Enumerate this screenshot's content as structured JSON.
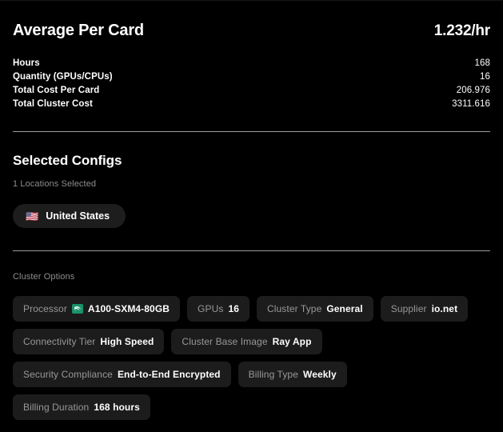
{
  "summary": {
    "title": "Average Per Card",
    "value": "1.232/hr",
    "stats": [
      {
        "label": "Hours",
        "value": "168"
      },
      {
        "label": "Quantity (GPUs/CPUs)",
        "value": "16"
      },
      {
        "label": "Total Cost Per Card",
        "value": "206.976"
      },
      {
        "label": "Total Cluster Cost",
        "value": "3311.616"
      }
    ]
  },
  "selected_configs": {
    "title": "Selected Configs",
    "subtitle": "1 Locations Selected",
    "locations": [
      {
        "flag": "flag-us-icon",
        "flag_glyph": "🇺🇸",
        "name": "United States"
      }
    ]
  },
  "cluster_options": {
    "label": "Cluster Options",
    "chips": [
      {
        "label": "Processor",
        "value": "A100-SXM4-80GB",
        "icon": "nvidia-icon"
      },
      {
        "label": "GPUs",
        "value": "16"
      },
      {
        "label": "Cluster Type",
        "value": "General"
      },
      {
        "label": "Supplier",
        "value": "io.net"
      },
      {
        "label": "Connectivity Tier",
        "value": "High Speed"
      },
      {
        "label": "Cluster Base Image",
        "value": "Ray App"
      },
      {
        "label": "Security Compliance",
        "value": "End-to-End Encrypted"
      },
      {
        "label": "Billing Type",
        "value": "Weekly"
      },
      {
        "label": "Billing Duration",
        "value": "168 hours"
      }
    ]
  },
  "colors": {
    "background": "#000000",
    "chip_background": "#1c1c1c",
    "divider": "#9c9c9c",
    "muted_text": "#8d8d8d",
    "nvidia_green": "#18936a"
  }
}
